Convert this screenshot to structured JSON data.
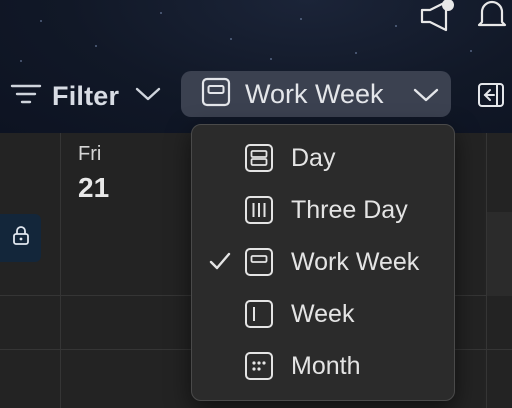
{
  "toolbar": {
    "filter_label": "Filter",
    "view_label": "Work Week",
    "icons": [
      "megaphone-icon",
      "bell-icon",
      "filter-lines-icon",
      "chevron-down-icon",
      "work-week-view-icon",
      "collapse-pane-icon"
    ]
  },
  "calendar": {
    "day_name": "Fri",
    "day_number": "21",
    "lock_icon": "lock-icon"
  },
  "view_menu": {
    "selected": "Work Week",
    "items": [
      {
        "label": "Day",
        "icon": "day-view-icon"
      },
      {
        "label": "Three Day",
        "icon": "three-day-view-icon"
      },
      {
        "label": "Work Week",
        "icon": "work-week-view-icon",
        "checked": true
      },
      {
        "label": "Week",
        "icon": "week-view-icon"
      },
      {
        "label": "Month",
        "icon": "month-view-icon"
      }
    ]
  },
  "colors": {
    "header_bg": "#111827",
    "view_button_bg": "#3b4150",
    "menu_bg": "#2b2b2b",
    "grid_bg": "#232323",
    "text": "#e4e4e4"
  }
}
